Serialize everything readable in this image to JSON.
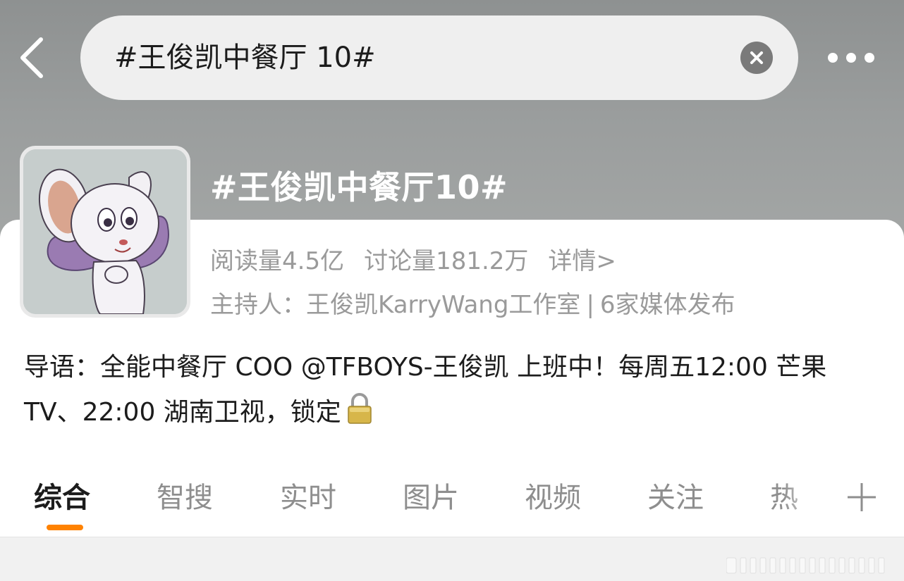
{
  "header": {
    "search_query": "#王俊凯中餐厅 10#"
  },
  "topic": {
    "title": "#王俊凯中餐厅10#",
    "reads": "阅读量4.5亿",
    "discussions": "讨论量181.2万",
    "details_link": "详情>",
    "host": "主持人：王俊凯KarryWang工作室",
    "separator": "|",
    "media": "6家媒体发布",
    "intro": "导语：全能中餐厅 COO @TFBOYS-王俊凯 上班中！每周五12:00 芒果 TV、22:00 湖南卫视，锁定"
  },
  "tabs": [
    {
      "label": "综合",
      "active": true
    },
    {
      "label": "智搜",
      "active": false
    },
    {
      "label": "实时",
      "active": false
    },
    {
      "label": "图片",
      "active": false
    },
    {
      "label": "视频",
      "active": false
    },
    {
      "label": "关注",
      "active": false
    },
    {
      "label": "热",
      "active": false
    }
  ],
  "icons": {
    "back": "chevron-left-icon",
    "clear": "close-circle-icon",
    "more": "more-horizontal-icon",
    "lock": "lock-icon",
    "add_tab": "plus-icon"
  },
  "colors": {
    "accent": "#ff8200",
    "muted_text": "#9a9a9a",
    "primary_text": "#1c1c1c"
  }
}
